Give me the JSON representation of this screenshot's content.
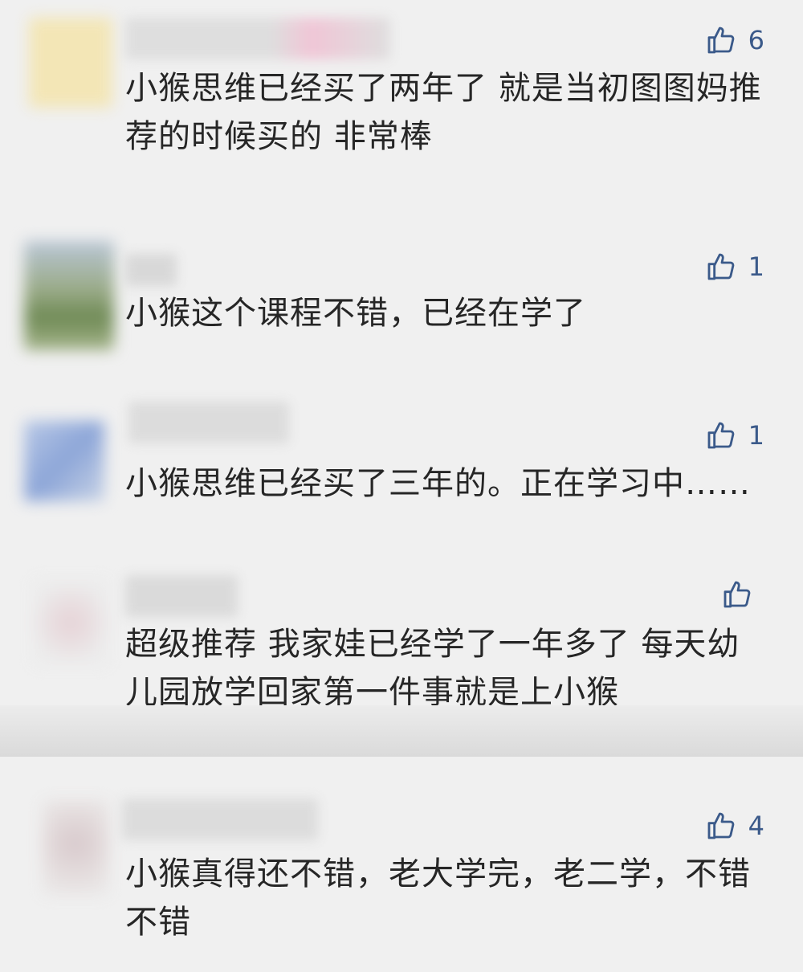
{
  "comments": [
    {
      "text": "小猴思维已经买了两年了 就是当初图图妈推荐的时候买的 非常棒",
      "likes": "6"
    },
    {
      "text": "小猴这个课程不错，已经在学了",
      "likes": "1"
    },
    {
      "text": "小猴思维已经买了三年的。正在学习中……",
      "likes": "1"
    },
    {
      "text": "超级推荐 我家娃已经学了一年多了 每天幼儿园放学回家第一件事就是上小猴",
      "likes": ""
    },
    {
      "text": "小猴真得还不错，老大学完，老二学，不错不错",
      "likes": "4"
    }
  ],
  "icons": {
    "like": "thumbs-up-icon"
  },
  "colors": {
    "background": "#f0f0f0",
    "accent": "#3b5a8a",
    "text": "#262626"
  }
}
